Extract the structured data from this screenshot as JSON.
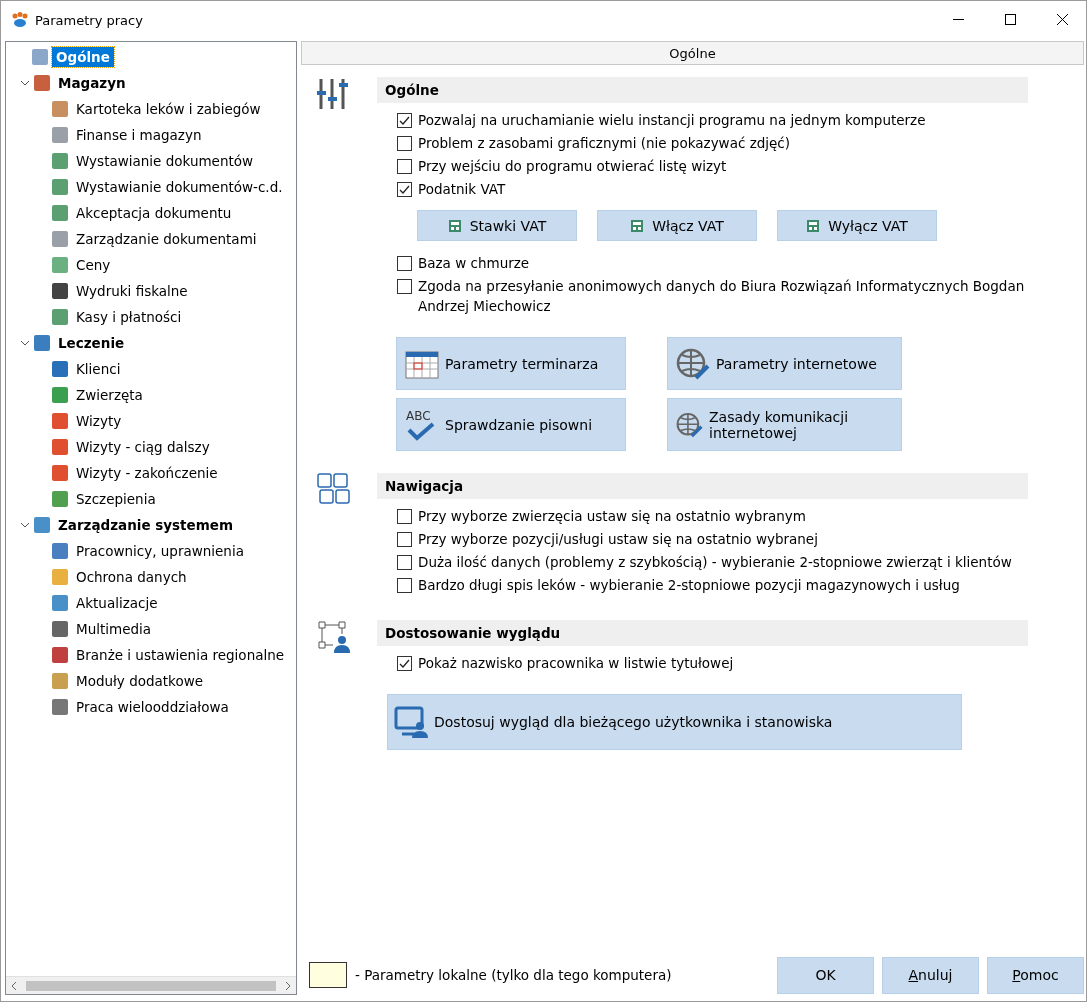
{
  "window": {
    "title": "Parametry pracy"
  },
  "tree": [
    {
      "label": "Ogólne",
      "selected": true
    },
    {
      "label": "Magazyn",
      "selected": false,
      "expanded": true,
      "children": [
        {
          "label": "Kartoteka leków i zabiegów",
          "selected": false
        },
        {
          "label": "Finanse i magazyn",
          "selected": false
        },
        {
          "label": "Wystawianie dokumentów",
          "selected": false
        },
        {
          "label": "Wystawianie dokumentów-c.d.",
          "selected": false
        },
        {
          "label": "Akceptacja dokumentu",
          "selected": false
        },
        {
          "label": "Zarządzanie dokumentami",
          "selected": false
        },
        {
          "label": "Ceny",
          "selected": false
        },
        {
          "label": "Wydruki fiskalne",
          "selected": false
        },
        {
          "label": "Kasy i płatności",
          "selected": false
        }
      ]
    },
    {
      "label": "Leczenie",
      "selected": false,
      "expanded": true,
      "children": [
        {
          "label": "Klienci",
          "selected": false
        },
        {
          "label": "Zwierzęta",
          "selected": false
        },
        {
          "label": "Wizyty",
          "selected": false
        },
        {
          "label": "Wizyty - ciąg dalszy",
          "selected": false
        },
        {
          "label": "Wizyty - zakończenie",
          "selected": false
        },
        {
          "label": "Szczepienia",
          "selected": false
        }
      ]
    },
    {
      "label": "Zarządzanie systemem",
      "selected": false,
      "expanded": true,
      "children": [
        {
          "label": "Pracownicy, uprawnienia",
          "selected": false
        },
        {
          "label": "Ochrona danych",
          "selected": false
        },
        {
          "label": "Aktualizacje",
          "selected": false
        },
        {
          "label": "Multimedia",
          "selected": false
        },
        {
          "label": "Branże i ustawienia regionalne",
          "selected": false
        },
        {
          "label": "Moduły dodatkowe",
          "selected": false
        },
        {
          "label": "Praca wielooddziałowa",
          "selected": false
        }
      ]
    }
  ],
  "panel_header": "Ogólne",
  "sections": [
    {
      "title": "Ogólne",
      "items": [
        {
          "kind": "checkbox",
          "label": "Pozwalaj na uruchamianie wielu instancji programu na jednym komputerze",
          "checked": true
        },
        {
          "kind": "checkbox",
          "label": "Problem z zasobami graficznymi (nie pokazywać zdjęć)",
          "checked": false
        },
        {
          "kind": "checkbox",
          "label": "Przy wejściu do programu otwierać listę wizyt",
          "checked": false
        },
        {
          "kind": "checkbox",
          "label": "Podatnik VAT",
          "checked": true
        },
        {
          "kind": "small_buttons",
          "buttons": [
            "Stawki VAT",
            "Włącz VAT",
            "Wyłącz VAT"
          ]
        },
        {
          "kind": "checkbox",
          "label": "Baza w chmurze",
          "checked": false
        },
        {
          "kind": "checkbox",
          "label": "Zgoda na przesyłanie anonimowych danych do Biura Rozwiązań Informatycznych Bogdan Andrzej Miechowicz",
          "checked": false
        },
        {
          "kind": "big_buttons",
          "buttons": [
            "Parametry terminarza",
            "Parametry internetowe",
            "Sprawdzanie pisowni",
            "Zasady komunikacji internetowej"
          ],
          "spellcheck_icon_text": "ABC"
        }
      ]
    },
    {
      "title": "Nawigacja",
      "items": [
        {
          "kind": "checkbox",
          "label": "Przy wyborze zwierzęcia ustaw się na ostatnio wybranym",
          "checked": false
        },
        {
          "kind": "checkbox",
          "label": "Przy wyborze pozycji/usługi ustaw się na ostatnio wybranej",
          "checked": false
        },
        {
          "kind": "checkbox",
          "label": "Duża ilość danych (problemy z szybkością) - wybieranie 2-stopniowe zwierząt i klientów",
          "checked": false
        },
        {
          "kind": "checkbox",
          "label": "Bardzo długi spis leków - wybieranie 2-stopniowe pozycji magazynowych i usług",
          "checked": false
        }
      ]
    },
    {
      "title": "Dostosowanie wyglądu",
      "items": [
        {
          "kind": "checkbox",
          "label": "Pokaż nazwisko pracownika w listwie tytułowej",
          "checked": true
        },
        {
          "kind": "wide_button",
          "label": "Dostosuj wygląd dla bieżącego użytkownika i stanowiska"
        }
      ]
    }
  ],
  "legend": "- Parametry lokalne (tylko dla tego komputera)",
  "footer_buttons": [
    {
      "label": "OK",
      "underline_first": false
    },
    {
      "label": "Anuluj",
      "underline_first": true
    },
    {
      "label": "Pomoc",
      "underline_first": true
    }
  ]
}
